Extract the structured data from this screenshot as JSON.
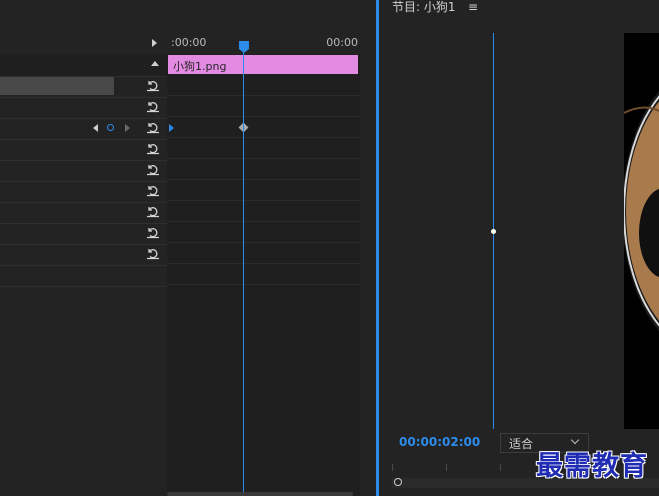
{
  "timeline": {
    "start_time": ":00:00",
    "end_time": "00:00",
    "clip_name": "小狗1.png"
  },
  "program": {
    "title": "节目: 小狗1",
    "menu_icon": "≡",
    "timecode": "00:00:02:00",
    "fit_label": "适合"
  },
  "watermark": "最需教育",
  "colors": {
    "accent": "#2d8ceb",
    "clip": "#e38be3",
    "panel_bg": "#232323",
    "dog_fur": "#a97a4c"
  },
  "icons": [
    "reset-icon",
    "keyframe-prev-icon",
    "keyframe-add-icon",
    "keyframe-next-icon",
    "collapse-arrow-icon",
    "expand-arrow-icon",
    "playhead-icon",
    "chevron-down-icon",
    "menu-icon"
  ]
}
